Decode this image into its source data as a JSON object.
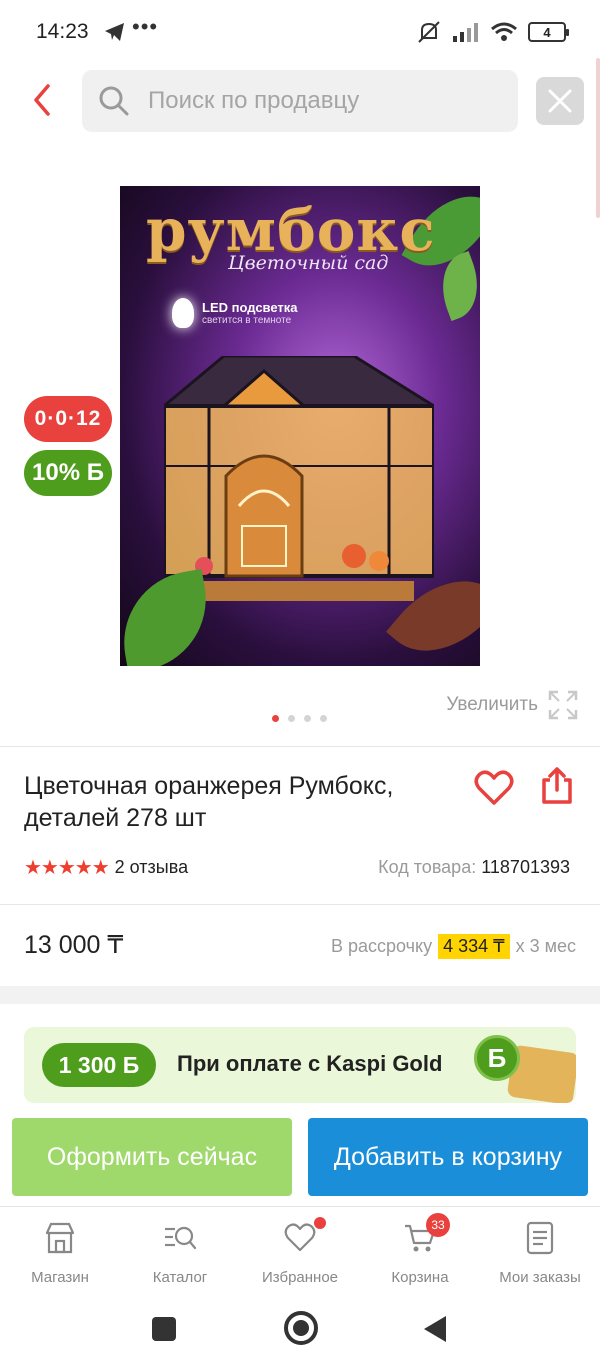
{
  "status_bar": {
    "time": "14:23",
    "dots": "•••",
    "battery": "4"
  },
  "header": {
    "search_placeholder": "Поиск по продавцу"
  },
  "image": {
    "brand_text": "румбокс",
    "subtitle": "Цветочный сад",
    "led_title": "LED подсветка",
    "led_sub": "светится в темноте"
  },
  "badges": {
    "timer": "0·0·12",
    "bonus": "10% Б"
  },
  "zoom_label": "Увеличить",
  "pager": {
    "count": 4,
    "active": 0
  },
  "product": {
    "title": "Цветочная оранжерея Румбокс, деталей 278 шт",
    "stars": "★★★★★",
    "rating_value": 5,
    "reviews": "2 отзыва",
    "code_label": "Код товара:",
    "code_value": "118701393",
    "price": "13 000 ₸",
    "installment_label": "В рассрочку",
    "installment_value": "4 334 ₸",
    "installment_term": "х 3 мес"
  },
  "kaspi": {
    "bonus": "1 300 Б",
    "text": "При оплате с Kaspi Gold",
    "coin": "Б"
  },
  "actions": {
    "buy_now": "Оформить сейчас",
    "add_to_cart": "Добавить в корзину"
  },
  "tabs": [
    {
      "label": "Магазин",
      "icon": "shop-icon"
    },
    {
      "label": "Каталог",
      "icon": "catalog-search-icon"
    },
    {
      "label": "Избранное",
      "icon": "heart-icon"
    },
    {
      "label": "Корзина",
      "icon": "cart-icon",
      "badge": "33"
    },
    {
      "label": "Мои заказы",
      "icon": "orders-icon"
    }
  ],
  "colors": {
    "accent_red": "#e8413e",
    "kaspi_green": "#4f9d1d",
    "cart_blue": "#1a8ed8",
    "buy_green": "#9fd86b",
    "installment_yellow": "#ffd400"
  }
}
